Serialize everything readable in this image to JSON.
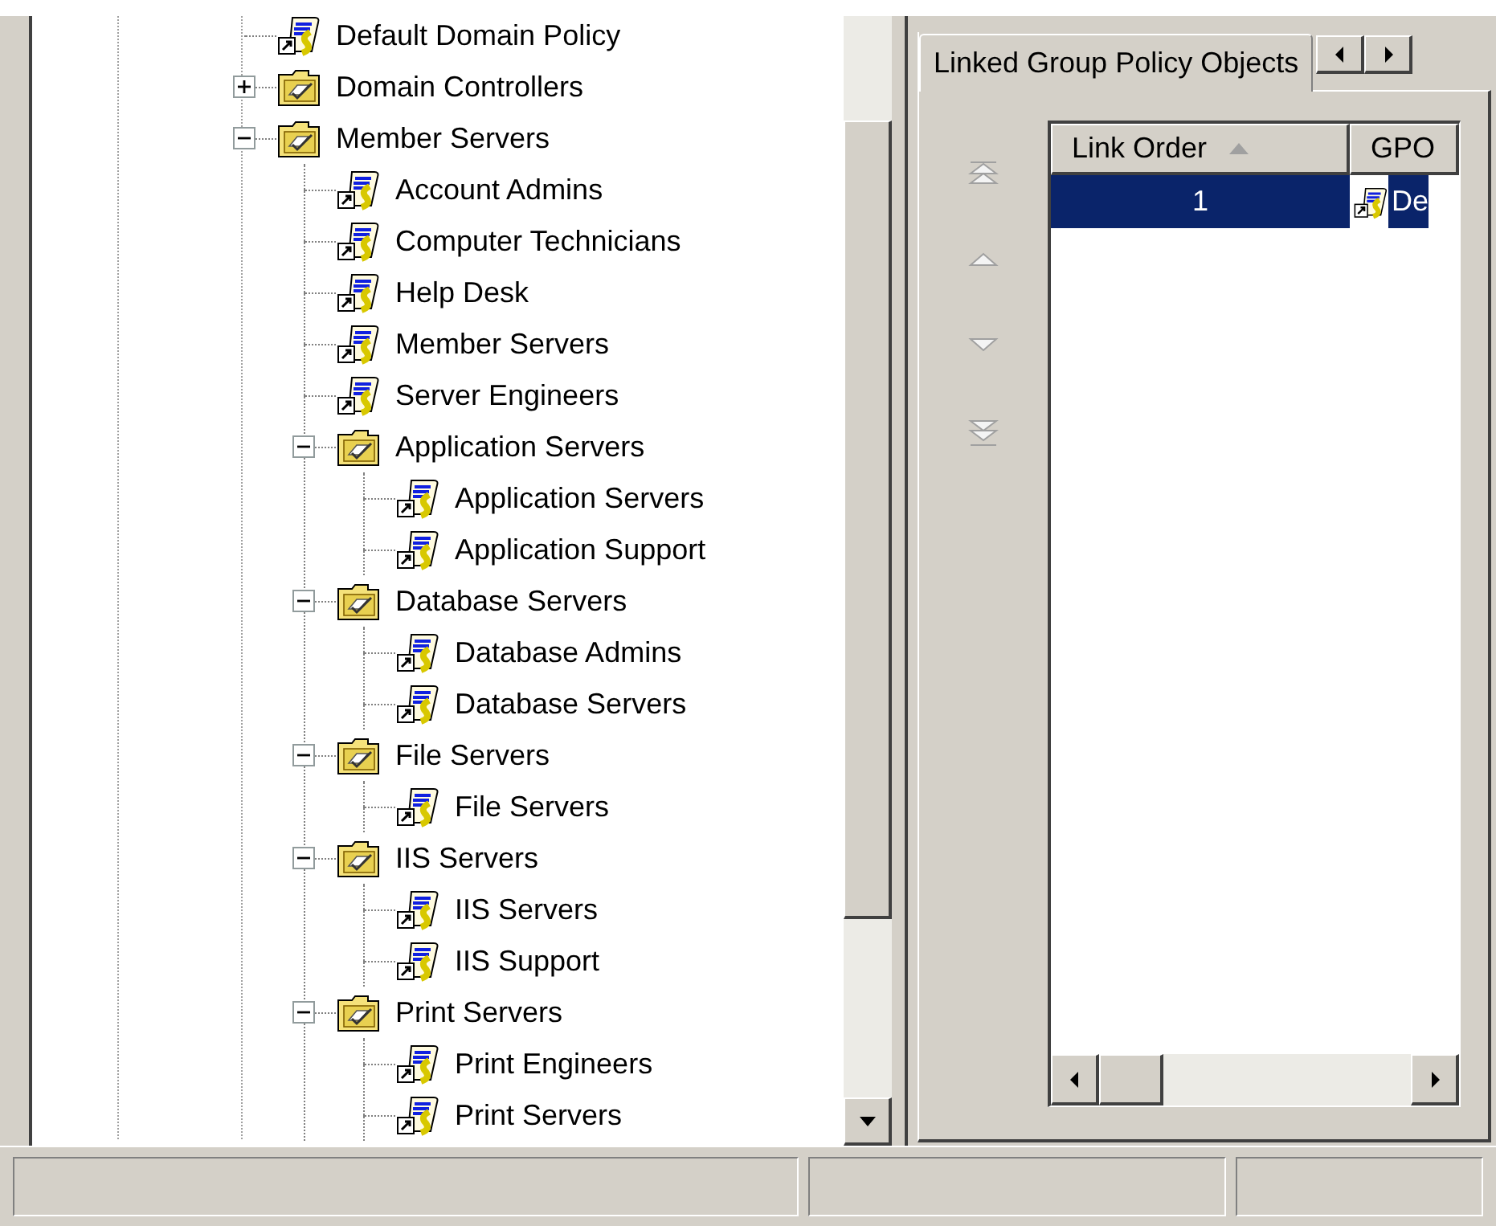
{
  "tree": {
    "items": [
      {
        "kind": "gpo",
        "label": "Default Domain Policy"
      },
      {
        "kind": "ou",
        "label": "Domain Controllers",
        "expanded": false
      },
      {
        "kind": "ou",
        "label": "Member Servers",
        "expanded": true,
        "children": [
          {
            "kind": "gpo",
            "label": "Account Admins"
          },
          {
            "kind": "gpo",
            "label": "Computer Technicians"
          },
          {
            "kind": "gpo",
            "label": "Help Desk"
          },
          {
            "kind": "gpo",
            "label": "Member Servers"
          },
          {
            "kind": "gpo",
            "label": "Server Engineers"
          },
          {
            "kind": "ou",
            "label": "Application Servers",
            "expanded": true,
            "children": [
              {
                "kind": "gpo",
                "label": "Application Servers"
              },
              {
                "kind": "gpo",
                "label": "Application Support"
              }
            ]
          },
          {
            "kind": "ou",
            "label": "Database Servers",
            "expanded": true,
            "children": [
              {
                "kind": "gpo",
                "label": "Database Admins"
              },
              {
                "kind": "gpo",
                "label": "Database Servers"
              }
            ]
          },
          {
            "kind": "ou",
            "label": "File Servers",
            "expanded": true,
            "children": [
              {
                "kind": "gpo",
                "label": "File Servers"
              }
            ]
          },
          {
            "kind": "ou",
            "label": "IIS Servers",
            "expanded": true,
            "children": [
              {
                "kind": "gpo",
                "label": "IIS Servers"
              },
              {
                "kind": "gpo",
                "label": "IIS Support"
              }
            ]
          },
          {
            "kind": "ou",
            "label": "Print Servers",
            "expanded": true,
            "children": [
              {
                "kind": "gpo",
                "label": "Print Engineers"
              },
              {
                "kind": "gpo",
                "label": "Print Servers"
              }
            ]
          }
        ]
      }
    ]
  },
  "details": {
    "tabs": [
      {
        "label": "Linked Group Policy Objects",
        "selected": true
      }
    ],
    "order_buttons": [
      {
        "kind": "top",
        "disabled": true
      },
      {
        "kind": "up",
        "disabled": true
      },
      {
        "kind": "down",
        "disabled": true
      },
      {
        "kind": "bottom",
        "disabled": true
      }
    ],
    "table": {
      "columns": [
        {
          "label": "Link Order",
          "sorted_ascending": true
        },
        {
          "label": "GPO"
        }
      ],
      "rows": [
        {
          "link_order": "1",
          "gpo": "De",
          "selected": true
        }
      ]
    }
  }
}
